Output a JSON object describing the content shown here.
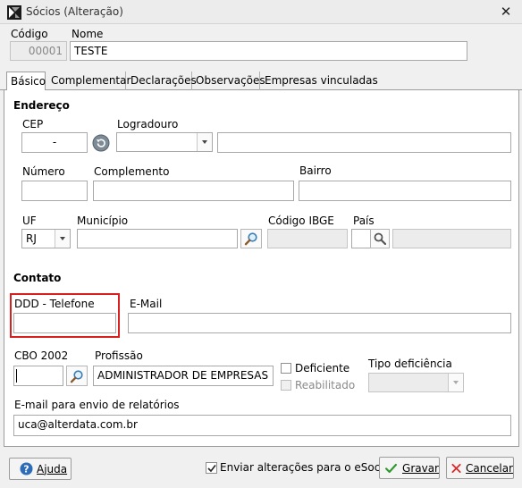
{
  "window": {
    "title": "Sócios (Alteração)",
    "close_glyph": "✕"
  },
  "header": {
    "codigo_label": "Código",
    "codigo_value": "00001",
    "nome_label": "Nome",
    "nome_value": "TESTE"
  },
  "tabs": [
    {
      "label": "Básico",
      "active": true
    },
    {
      "label": "Complementar",
      "active": false
    },
    {
      "label": "Declarações",
      "active": false
    },
    {
      "label": "Observações",
      "active": false
    },
    {
      "label": "Empresas vinculadas",
      "active": false
    }
  ],
  "endereco": {
    "section_title": "Endereço",
    "cep_label": "CEP",
    "cep_value": "-",
    "logradouro_label": "Logradouro",
    "logradouro_type_value": "",
    "logradouro_value": "",
    "numero_label": "Número",
    "numero_value": "",
    "complemento_label": "Complemento",
    "complemento_value": "",
    "bairro_label": "Bairro",
    "bairro_value": "",
    "uf_label": "UF",
    "uf_value": "RJ",
    "municipio_label": "Município",
    "municipio_value": "",
    "codigo_ibge_label": "Código IBGE",
    "codigo_ibge_value": "",
    "pais_label": "País",
    "pais_code_value": "",
    "pais_name_value": ""
  },
  "contato": {
    "section_title": "Contato",
    "ddd_label": "DDD - Telefone",
    "ddd_value": "",
    "email_label": "E-Mail",
    "email_value": ""
  },
  "profissional": {
    "cbo_label": "CBO 2002",
    "cbo_value": "",
    "profissao_label": "Profissão",
    "profissao_value": "ADMINISTRADOR DE EMPRESAS",
    "deficiente_label": "Deficiente",
    "deficiente_checked": false,
    "reabilitado_label": "Reabilitado",
    "reabilitado_checked": false,
    "tipo_deficiencia_label": "Tipo deficiência",
    "tipo_deficiencia_value": ""
  },
  "relatorios": {
    "email_label": "E-mail para envio de relatórios",
    "email_value": "uca@alterdata.com.br"
  },
  "footer": {
    "ajuda_label": "Ajuda",
    "esocial_label": "Enviar alterações para o eSocial",
    "esocial_checked": true,
    "gravar_label": "Gravar",
    "cancelar_label": "Cancelar"
  },
  "colors": {
    "highlight": "#d82020",
    "panel_bg": "#ffffff",
    "window_bg": "#f0f0f0"
  },
  "icons": {
    "app": "app-logo-icon",
    "cep_search": "cep-lookup-icon",
    "search": "magnifier-icon",
    "help": "help-icon",
    "save": "checkmark-icon",
    "cancel": "cancel-x-icon"
  }
}
